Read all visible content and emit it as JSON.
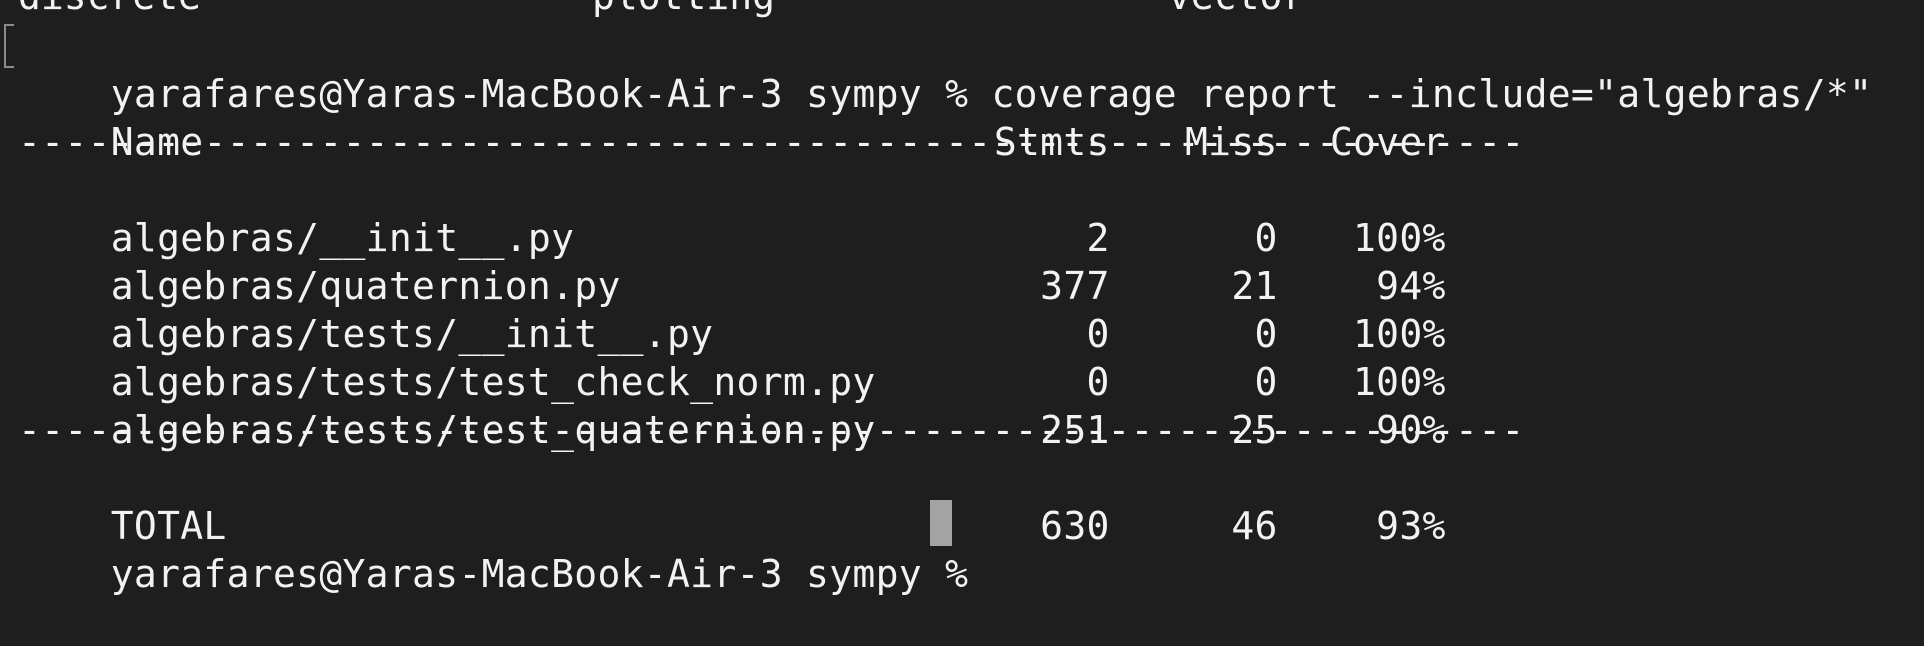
{
  "terminal": {
    "top_partial": [
      "discrete",
      "plotting",
      "vector"
    ],
    "command_prompt": "yarafares@Yaras-MacBook-Air-3 sympy % ",
    "command": "coverage report --include=\"algebras/*\"",
    "header": {
      "name": "Name",
      "stmts": "Stmts",
      "miss": "Miss",
      "cover": "Cover"
    },
    "separator": "-----------------------------------------------------------------",
    "rows": [
      {
        "name": "algebras/__init__.py",
        "stmts": "2",
        "miss": "0",
        "cover": "100%"
      },
      {
        "name": "algebras/quaternion.py",
        "stmts": "377",
        "miss": "21",
        "cover": "94%"
      },
      {
        "name": "algebras/tests/__init__.py",
        "stmts": "0",
        "miss": "0",
        "cover": "100%"
      },
      {
        "name": "algebras/tests/test_check_norm.py",
        "stmts": "0",
        "miss": "0",
        "cover": "100%"
      },
      {
        "name": "algebras/tests/test_quaternion.py",
        "stmts": "251",
        "miss": "25",
        "cover": "90%"
      }
    ],
    "total": {
      "name": "TOTAL",
      "stmts": "630",
      "miss": "46",
      "cover": "93%"
    },
    "final_prompt": "yarafares@Yaras-MacBook-Air-3 sympy % "
  }
}
